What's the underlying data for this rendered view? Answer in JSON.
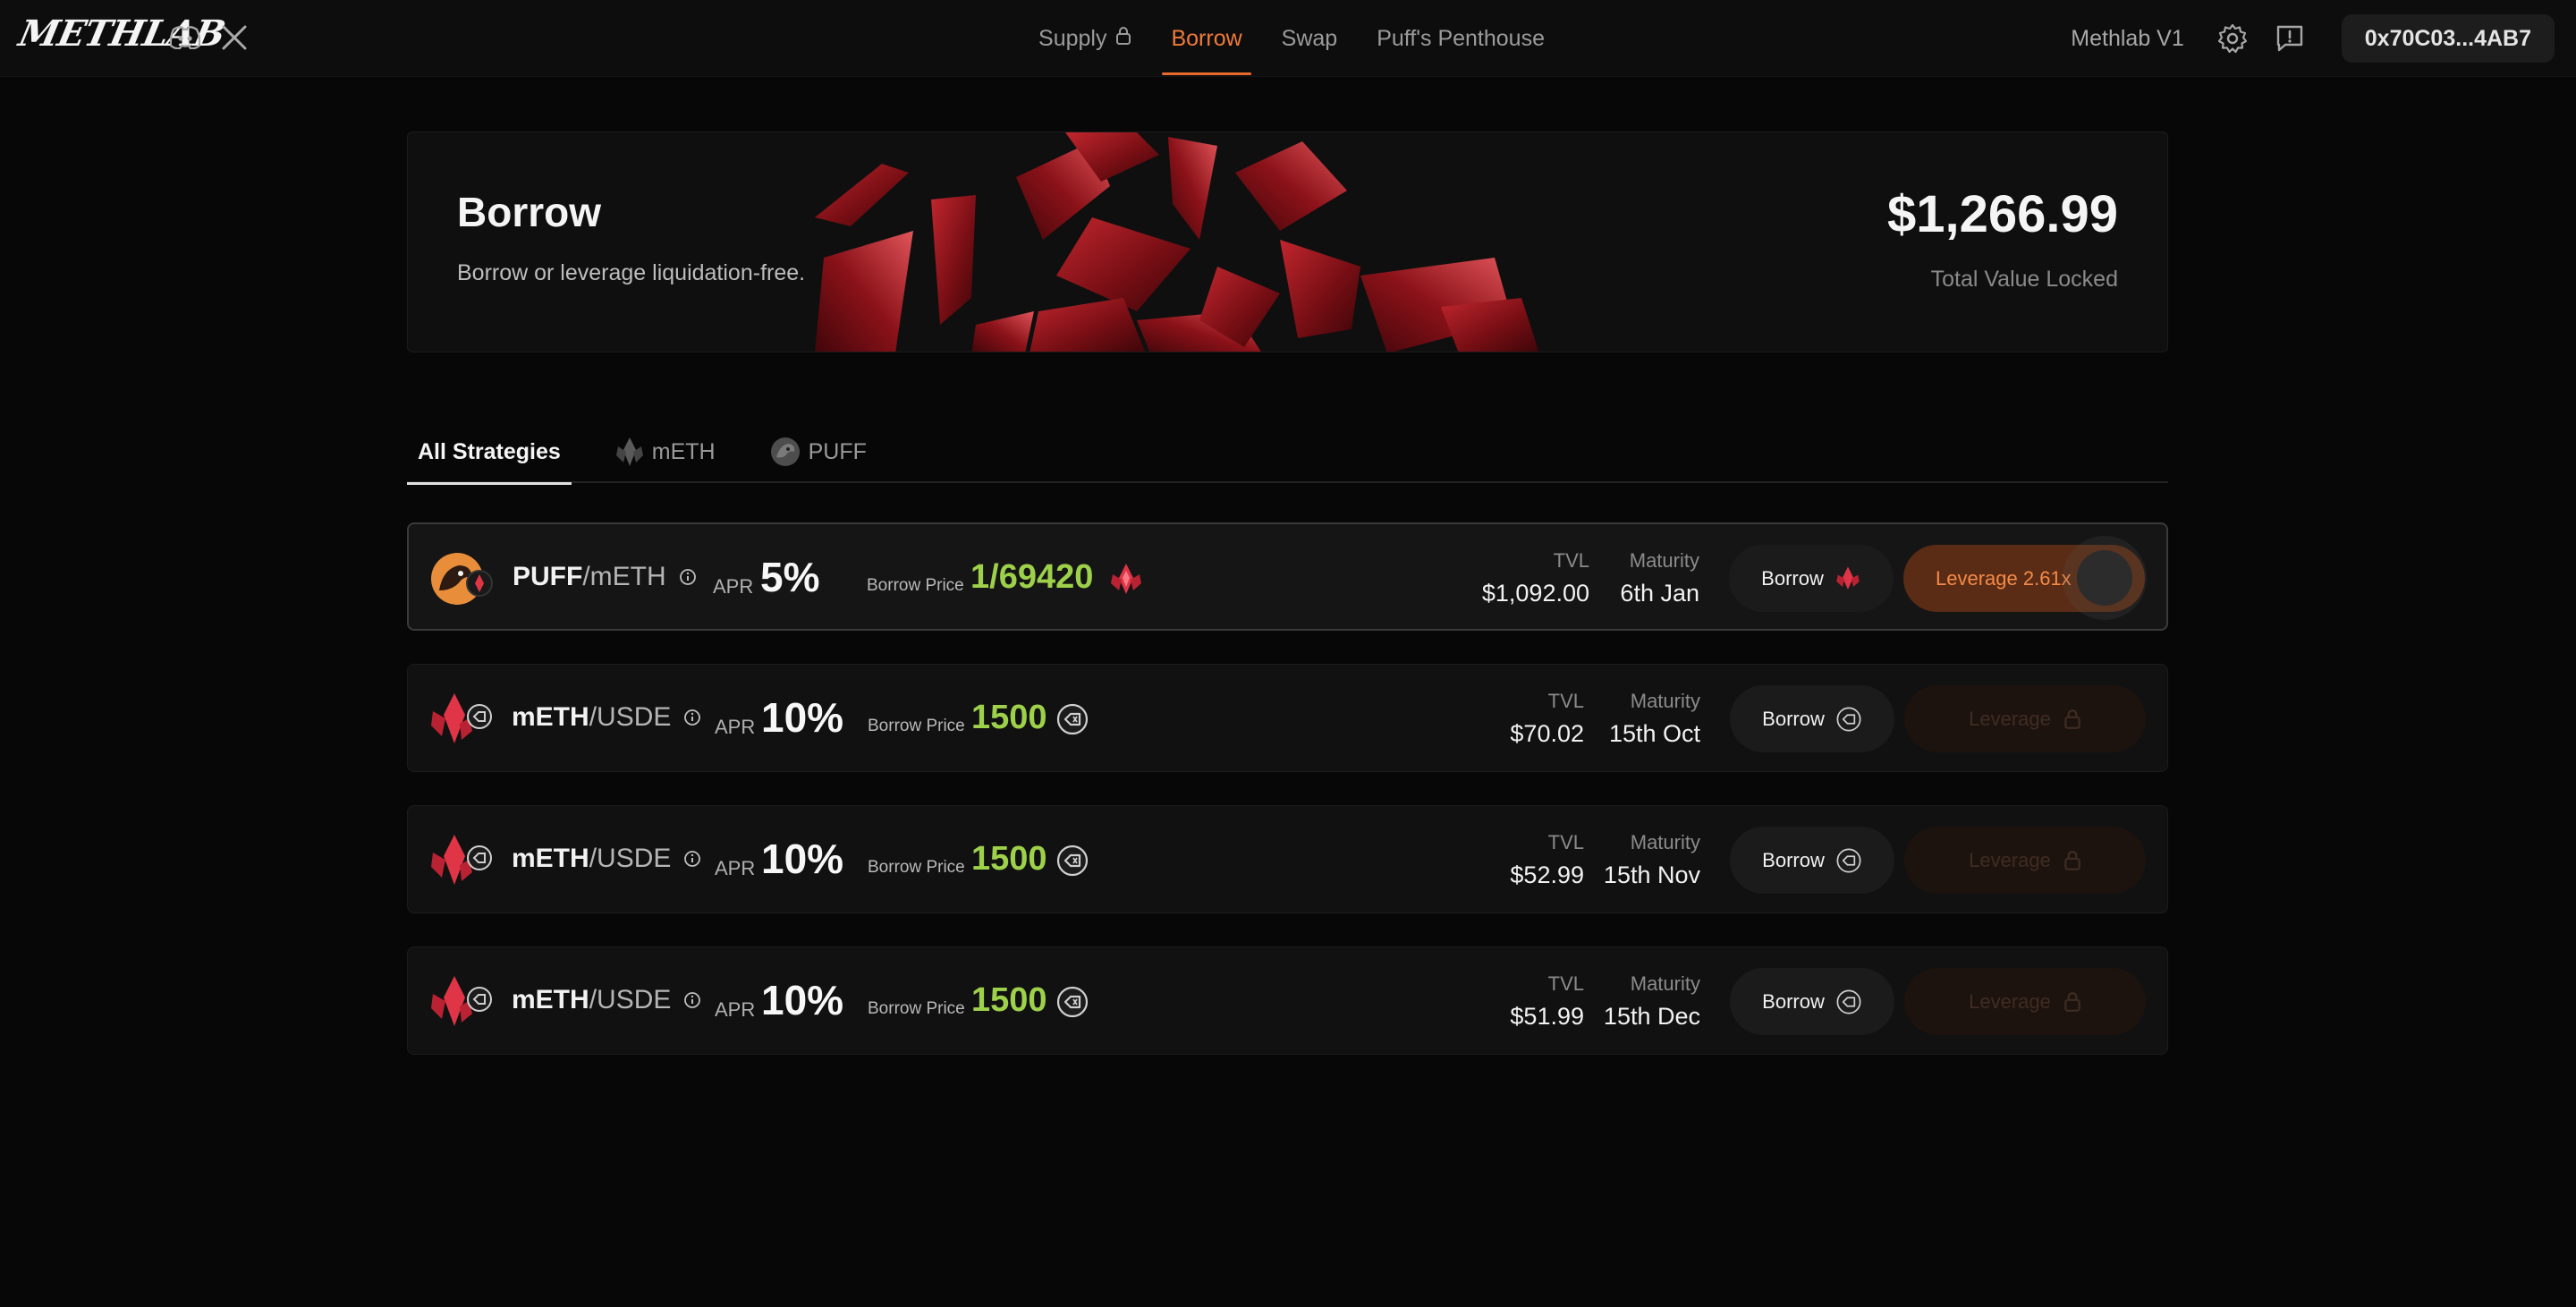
{
  "brand": {
    "logo": "METHLAB"
  },
  "nav": {
    "items": [
      {
        "label": "Supply",
        "locked": true
      },
      {
        "label": "Borrow",
        "active": true
      },
      {
        "label": "Swap"
      },
      {
        "label": "Puff's Penthouse"
      }
    ]
  },
  "header": {
    "version": "Methlab V1",
    "wallet": "0x70C03...4AB7"
  },
  "hero": {
    "title": "Borrow",
    "subtitle": "Borrow or leverage liquidation-free.",
    "tvl_value": "$1,266.99",
    "tvl_label": "Total Value Locked"
  },
  "tabs": [
    {
      "label": "All Strategies",
      "active": true
    },
    {
      "label": "mETH",
      "icon": "meth-icon"
    },
    {
      "label": "PUFF",
      "icon": "puff-icon"
    }
  ],
  "rows": [
    {
      "base": "PUFF",
      "sep": "/",
      "quote": "mETH",
      "apr_label": "APR",
      "apr": "5%",
      "bp_label": "Borrow Price",
      "bp": "1/69420",
      "tvl_label": "TVL",
      "tvl": "$1,092.00",
      "maturity_label": "Maturity",
      "maturity": "6th Jan",
      "borrow": "Borrow",
      "leverage": "Leverage 2.61x",
      "leverage_enabled": true
    },
    {
      "base": "mETH",
      "sep": "/",
      "quote": "USDE",
      "apr_label": "APR",
      "apr": "10%",
      "bp_label": "Borrow Price",
      "bp": "1500",
      "tvl_label": "TVL",
      "tvl": "$70.02",
      "maturity_label": "Maturity",
      "maturity": "15th Oct",
      "borrow": "Borrow",
      "leverage": "Leverage",
      "leverage_enabled": false
    },
    {
      "base": "mETH",
      "sep": "/",
      "quote": "USDE",
      "apr_label": "APR",
      "apr": "10%",
      "bp_label": "Borrow Price",
      "bp": "1500",
      "tvl_label": "TVL",
      "tvl": "$52.99",
      "maturity_label": "Maturity",
      "maturity": "15th Nov",
      "borrow": "Borrow",
      "leverage": "Leverage",
      "leverage_enabled": false
    },
    {
      "base": "mETH",
      "sep": "/",
      "quote": "USDE",
      "apr_label": "APR",
      "apr": "10%",
      "bp_label": "Borrow Price",
      "bp": "1500",
      "tvl_label": "TVL",
      "tvl": "$51.99",
      "maturity_label": "Maturity",
      "maturity": "15th Dec",
      "borrow": "Borrow",
      "leverage": "Leverage",
      "leverage_enabled": false
    }
  ],
  "colors": {
    "accent": "#e86a2c",
    "price_green": "#9ed14a",
    "meth_red": "#e03447"
  }
}
